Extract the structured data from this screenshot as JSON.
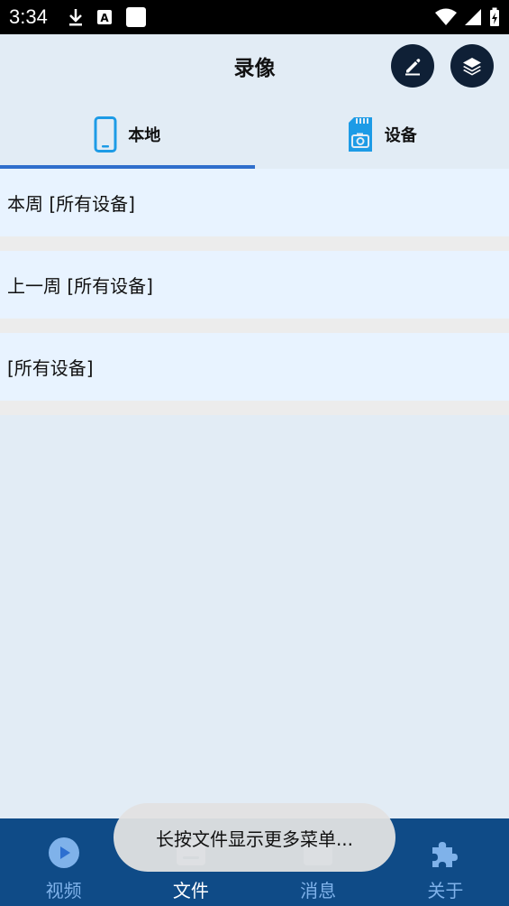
{
  "status_bar": {
    "time": "3:34"
  },
  "header": {
    "title": "录像"
  },
  "tabs": [
    {
      "label": "本地",
      "active": true
    },
    {
      "label": "设备",
      "active": false
    }
  ],
  "list": [
    {
      "label": "本周  [所有设备]"
    },
    {
      "label": "上一周  [所有设备]"
    },
    {
      "label": "[所有设备]"
    }
  ],
  "bottom_nav": [
    {
      "label": "视频",
      "icon": "video-icon"
    },
    {
      "label": "文件",
      "icon": "file-icon",
      "active": true
    },
    {
      "label": "消息",
      "icon": "message-icon"
    },
    {
      "label": "关于",
      "icon": "puzzle-icon"
    }
  ],
  "toast": {
    "text": "长按文件显示更多菜单..."
  },
  "colors": {
    "accent": "#2f6fcc",
    "header_button": "#0f2036",
    "bottom_nav": "#0f4b87",
    "list_item_bg": "#e8f3ff",
    "page_bg": "#e2ecf5"
  }
}
